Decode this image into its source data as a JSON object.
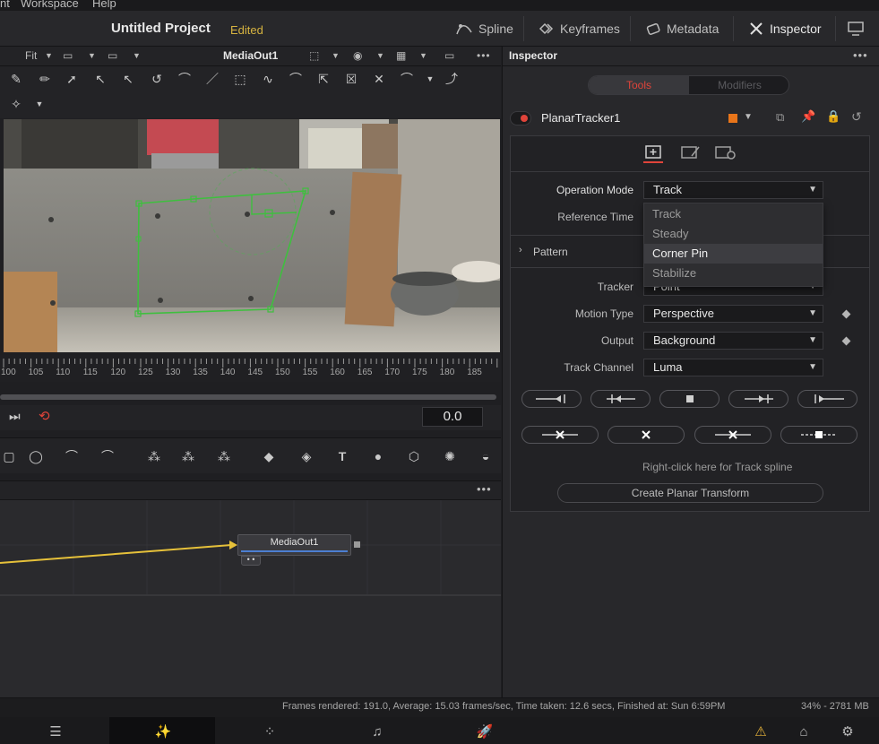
{
  "menubar": {
    "items": [
      "nt",
      "Workspace",
      "Help"
    ]
  },
  "header": {
    "project_title": "Untitled Project",
    "project_status": "Edited",
    "spline": "Spline",
    "keyframes": "Keyframes",
    "metadata": "Metadata",
    "inspector": "Inspector"
  },
  "viewer_toolbar": {
    "fit": "Fit",
    "viewer_name": "MediaOut1"
  },
  "ruler": {
    "ticks": [
      "100",
      "105",
      "110",
      "115",
      "120",
      "125",
      "130",
      "135",
      "140",
      "145",
      "150",
      "155",
      "160",
      "165",
      "170",
      "175",
      "180",
      "185"
    ]
  },
  "transport": {
    "timecode": "0.0"
  },
  "node_editor": {
    "node_label": "MediaOut1"
  },
  "inspector": {
    "title": "Inspector",
    "tab_tools": "Tools",
    "tab_modifiers": "Modifiers",
    "tool_name": "PlanarTracker1",
    "tool_color": "#e8751a",
    "fields": {
      "operation_mode_label": "Operation Mode",
      "operation_mode_value": "Track",
      "reference_time_label": "Reference Time",
      "pattern_label": "Pattern",
      "tracker_label": "Tracker",
      "tracker_value": "Point",
      "motion_type_label": "Motion Type",
      "motion_type_value": "Perspective",
      "output_label": "Output",
      "output_value": "Background",
      "track_channel_label": "Track Channel",
      "track_channel_value": "Luma"
    },
    "dropdown_options": [
      "Track",
      "Steady",
      "Corner Pin",
      "Stabilize"
    ],
    "dropdown_highlighted": "Corner Pin",
    "hint": "Right-click here for Track spline",
    "create_button": "Create Planar Transform"
  },
  "status": {
    "text": "Frames rendered: 191.0,  Average: 15.03 frames/sec,  Time taken: 12.6 secs,  Finished at: Sun 6:59PM",
    "memory": "34% - 2781 MB"
  },
  "colors": {
    "accent_red": "#e0443a",
    "accent_yellow": "#d6b340",
    "track_green": "#3fbf3f"
  }
}
